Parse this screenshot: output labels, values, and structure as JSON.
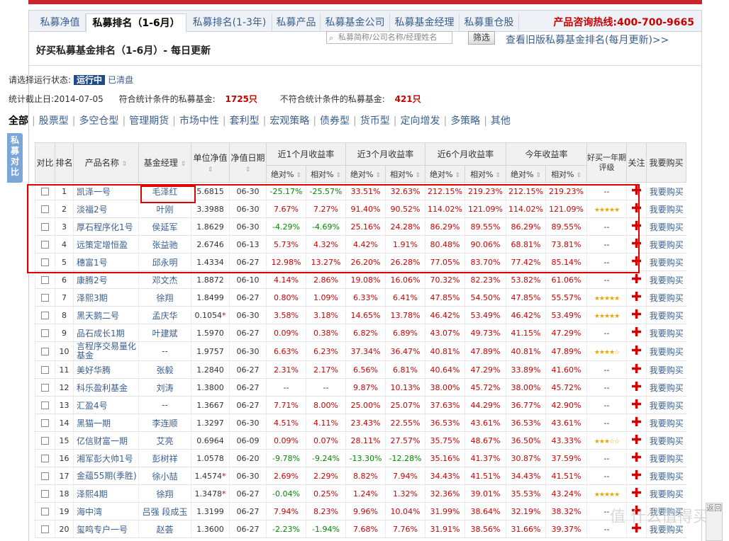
{
  "tabs": [
    {
      "label": "私募净值"
    },
    {
      "label": "私募排名（1-6月）"
    },
    {
      "label": "私募排名(1-3年)"
    },
    {
      "label": "私募产品"
    },
    {
      "label": "私募基金公司"
    },
    {
      "label": "私募基金经理"
    },
    {
      "label": "私募重仓股"
    }
  ],
  "hotline": "产品咨询热线:400-700-9665",
  "page_title": "好买私募基金排名（1-6月）- 每日更新",
  "search_placeholder": "私募简称/公司名称/经理姓名",
  "filter_button": "筛选",
  "old_link": "查看旧版私募基金排名(每月更新)>>",
  "status": {
    "prompt": "请选择运行状态:",
    "running": "运行中",
    "cleared": "已清盘"
  },
  "stats": {
    "date_label": "统计截止日:2014-07-05",
    "match_label": "符合统计条件的私募基金:",
    "match_count": "1725只",
    "nomatch_label": "不符合统计条件的私募基金:",
    "nomatch_count": "421只"
  },
  "categories": [
    "全部",
    "股票型",
    "多空仓型",
    "管理期货",
    "市场中性",
    "套利型",
    "宏观策略",
    "债券型",
    "货币型",
    "定向增发",
    "多策略",
    "其他"
  ],
  "side_tab": "私募对比",
  "headers": {
    "compare": "对比",
    "rank": "排名",
    "name": "产品名称",
    "manager": "基金经理",
    "nav": "单位净值",
    "nav_date": "净值日期",
    "r1m": "近1个月收益率",
    "r3m": "近3个月收益率",
    "r6m": "近6个月收益率",
    "ytd": "今年收益率",
    "rating": "好买一年期评级",
    "follow": "关注",
    "buy": "我要购买",
    "abs": "绝对%",
    "rel": "相对%"
  },
  "rows": [
    [
      "1",
      "凯泽一号",
      "毛泽红",
      "5.6815",
      "06-30",
      "-25.17%",
      "-25.57%",
      "33.51%",
      "32.63%",
      "212.15%",
      "219.23%",
      "212.15%",
      "219.23%",
      "--"
    ],
    [
      "2",
      "淡福2号",
      "叶刚",
      "3.3988",
      "06-30",
      "7.67%",
      "7.27%",
      "91.40%",
      "90.52%",
      "114.02%",
      "121.09%",
      "114.02%",
      "121.09%",
      "5"
    ],
    [
      "3",
      "厚石程序化1号",
      "侯延军",
      "1.8629",
      "06-30",
      "-4.29%",
      "-4.69%",
      "25.16%",
      "24.28%",
      "86.29%",
      "89.55%",
      "86.29%",
      "89.55%",
      "--"
    ],
    [
      "4",
      "远策定增恒盈",
      "张益驰",
      "2.6746",
      "06-13",
      "5.73%",
      "4.32%",
      "4.42%",
      "1.91%",
      "80.48%",
      "90.06%",
      "68.81%",
      "73.81%",
      "--"
    ],
    [
      "5",
      "穗富1号",
      "邱永明",
      "1.4334",
      "06-27",
      "12.98%",
      "13.27%",
      "26.20%",
      "26.28%",
      "77.05%",
      "83.70%",
      "77.42%",
      "85.14%",
      "--"
    ],
    [
      "6",
      "康腾2号",
      "邓文杰",
      "1.8872",
      "06-10",
      "4.14%",
      "2.86%",
      "19.08%",
      "16.06%",
      "70.32%",
      "82.23%",
      "53.82%",
      "61.06%",
      "--"
    ],
    [
      "7",
      "泽熙3期",
      "徐翔",
      "1.8499",
      "06-27",
      "0.80%",
      "1.09%",
      "6.33%",
      "6.41%",
      "47.85%",
      "54.50%",
      "47.85%",
      "55.57%",
      "5"
    ],
    [
      "8",
      "黑天鹅二号",
      "孟庆华",
      "0.1054*",
      "06-30",
      "3.58%",
      "3.18%",
      "14.65%",
      "13.78%",
      "46.42%",
      "53.49%",
      "46.42%",
      "53.49%",
      "5"
    ],
    [
      "9",
      "品石成长1期",
      "叶建斌",
      "1.5970",
      "06-27",
      "0.09%",
      "0.38%",
      "6.82%",
      "6.89%",
      "43.07%",
      "49.73%",
      "41.15%",
      "47.29%",
      "--"
    ],
    [
      "10",
      "言程序交易量化基金",
      "--",
      "1.9757",
      "06-30",
      "6.63%",
      "6.23%",
      "37.34%",
      "36.47%",
      "40.81%",
      "47.89%",
      "40.81%",
      "47.89%",
      "4"
    ],
    [
      "11",
      "美好华腾",
      "张毅",
      "1.2840",
      "06-27",
      "2.31%",
      "2.17%",
      "6.56%",
      "6.81%",
      "40.64%",
      "47.29%",
      "33.89%",
      "41.60%",
      "--"
    ],
    [
      "12",
      "科乐盈利基金",
      "刘涛",
      "1.3800",
      "06-27",
      "--",
      "--",
      "9.87%",
      "10.13%",
      "38.00%",
      "45.72%",
      "38.00%",
      "45.72%",
      "--"
    ],
    [
      "13",
      "汇盈4号",
      "--",
      "1.3667",
      "06-27",
      "7.71%",
      "8.00%",
      "25.00%",
      "25.07%",
      "37.63%",
      "44.29%",
      "36.77%",
      "42.90%",
      "--"
    ],
    [
      "14",
      "黑猫一期",
      "李连顺",
      "1.3297",
      "06-30",
      "4.51%",
      "4.11%",
      "23.43%",
      "22.55%",
      "36.53%",
      "43.61%",
      "36.53%",
      "43.61%",
      "--"
    ],
    [
      "15",
      "亿信财富一期",
      "艾亮",
      "0.6964",
      "06-09",
      "0.09%",
      "0.07%",
      "28.11%",
      "27.57%",
      "35.75%",
      "48.67%",
      "36.50%",
      "43.33%",
      "3"
    ],
    [
      "16",
      "湘军彭大帅1号",
      "彭树祥",
      "1.0578",
      "06-20",
      "-9.78%",
      "-9.24%",
      "-13.30%",
      "-12.28%",
      "35.16%",
      "41.37%",
      "30.87%",
      "37.59%",
      "--"
    ],
    [
      "17",
      "金蕴55期(季胜)",
      "徐小喆",
      "1.4574*",
      "06-30",
      "2.69%",
      "2.29%",
      "8.82%",
      "7.94%",
      "34.43%",
      "41.51%",
      "34.43%",
      "41.51%",
      "--"
    ],
    [
      "18",
      "泽熙4期",
      "徐翔",
      "1.3478*",
      "06-27",
      "-0.04%",
      "0.25%",
      "1.24%",
      "1.32%",
      "32.36%",
      "39.01%",
      "35.53%",
      "43.24%",
      "5"
    ],
    [
      "19",
      "海中湾",
      "吕强 段成玉",
      "1.3199",
      "06-27",
      "7.94%",
      "8.23%",
      "9.96%",
      "10.04%",
      "31.99%",
      "38.64%",
      "32.19%",
      "38.32%",
      "--"
    ],
    [
      "20",
      "玺鸣专户一号",
      "赵荟",
      "1.3600",
      "06-27",
      "-2.23%",
      "-1.94%",
      "7.68%",
      "7.76%",
      "31.91%",
      "38.56%",
      "31.66%",
      "39.37%",
      "--"
    ]
  ],
  "follow_symbol": "✚",
  "buy_label": "我要购买",
  "watermark": "值 什么值得买",
  "back_top": "返回"
}
